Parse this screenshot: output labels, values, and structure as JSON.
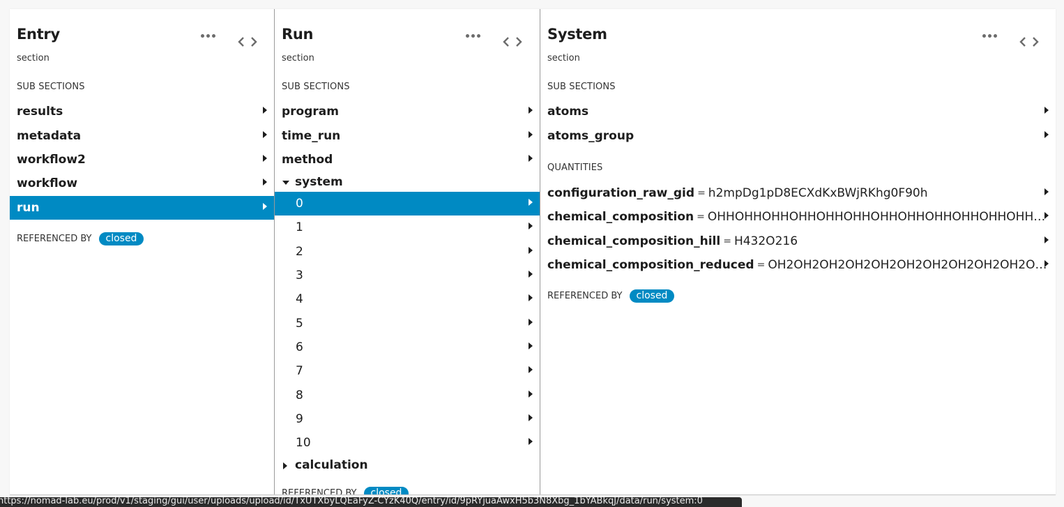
{
  "lanes": [
    {
      "title": "Entry",
      "subtitle": "section",
      "subsections_label": "SUB SECTIONS",
      "subsections": [
        "results",
        "metadata",
        "workflow2",
        "workflow",
        "run"
      ],
      "selected": "run",
      "referenced_by_label": "REFERENCED BY",
      "referenced_by_chip": "closed"
    },
    {
      "title": "Run",
      "subtitle": "section",
      "subsections_label": "SUB SECTIONS",
      "subsections": [
        "program",
        "time_run",
        "method"
      ],
      "expanded_group": {
        "label": "system",
        "state": "expanded",
        "indices": [
          "0",
          "1",
          "2",
          "3",
          "4",
          "5",
          "6",
          "7",
          "8",
          "9",
          "10"
        ],
        "selected": "0"
      },
      "collapsed_group": {
        "label": "calculation",
        "state": "collapsed"
      },
      "referenced_by_label": "REFERENCED BY",
      "referenced_by_chip": "closed"
    },
    {
      "title": "System",
      "subtitle": "section",
      "subsections_label": "SUB SECTIONS",
      "subsections": [
        "atoms",
        "atoms_group"
      ],
      "quantities_label": "QUANTITIES",
      "quantities": [
        {
          "name": "configuration_raw_gid",
          "value": "h2mpDg1pD8ECXdKxBWjRKhg0F90h"
        },
        {
          "name": "chemical_composition",
          "value": "OHHOHHOHHOHHOHHOHHOHHOHHOHHOHHOHHOHHO..."
        },
        {
          "name": "chemical_composition_hill",
          "value": "H432O216"
        },
        {
          "name": "chemical_composition_reduced",
          "value": "OH2OH2OH2OH2OH2OH2OH2OH2OH2OH2OH..."
        }
      ],
      "referenced_by_label": "REFERENCED BY",
      "referenced_by_chip": "closed"
    }
  ],
  "equals_sign": "=",
  "icons": {
    "more": "more-horizontal-icon",
    "code": "code-icon",
    "arrow": "arrow-right-icon"
  },
  "colors": {
    "accent": "#008ac3"
  },
  "status_bar": {
    "url": "https://nomad-lab.eu/prod/v1/staging/gui/user/uploads/upload/id/TxUTXbyLQEaFyZ-CYzK40Q/entry/id/9pRYjuaAwxH5b3N8Xbg_1bYABkqJ/data/run/system:0"
  }
}
